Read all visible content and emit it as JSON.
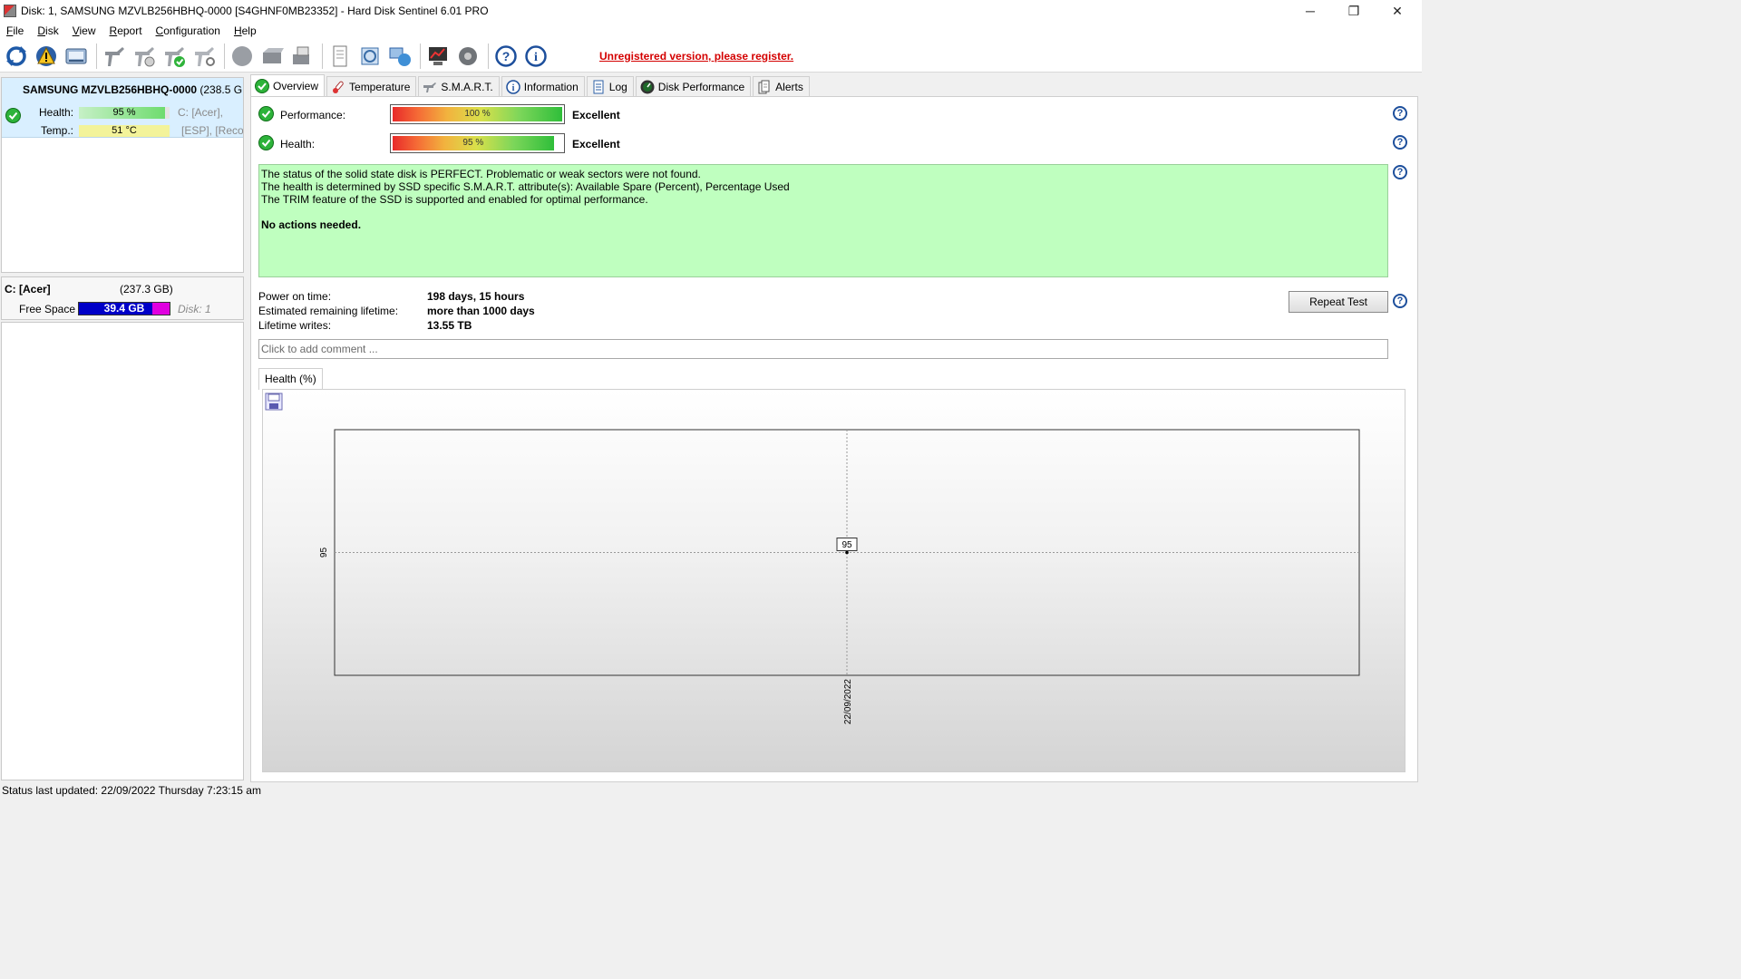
{
  "window": {
    "title": "Disk: 1, SAMSUNG MZVLB256HBHQ-0000 [S4GHNF0MB23352]  -  Hard Disk Sentinel 6.01 PRO",
    "minimize": "─",
    "maximize": "❐",
    "close": "✕"
  },
  "menu": [
    {
      "label": "File",
      "key": "F",
      "rest": "ile"
    },
    {
      "label": "Disk",
      "key": "D",
      "rest": "isk"
    },
    {
      "label": "View",
      "key": "V",
      "rest": "iew"
    },
    {
      "label": "Report",
      "key": "R",
      "rest": "eport"
    },
    {
      "label": "Configuration",
      "key": "C",
      "rest": "onfiguration"
    },
    {
      "label": "Help",
      "key": "H",
      "rest": "elp"
    }
  ],
  "toolbar": {
    "register_text": "Unregistered version, please register.",
    "icons": [
      "refresh-icon",
      "alert-icon",
      "disk-drive-icon",
      "sep",
      "wrench-icon",
      "test-icon",
      "wrench-check-icon",
      "wrench-settings-icon",
      "sep2",
      "circle-icon",
      "server-icon",
      "printer-icon",
      "sep3",
      "report-icon",
      "send-icon",
      "network-icon",
      "sep4",
      "chart-monitor-icon",
      "speaker-icon",
      "sep5",
      "help-icon",
      "info-icon"
    ]
  },
  "left": {
    "disk_name": "SAMSUNG MZVLB256HBHQ-0000",
    "disk_size": "(238.5 G",
    "health_label": "Health:",
    "health_value": "95 %",
    "health_fraction": 0.95,
    "temp_label": "Temp.:",
    "temp_value": "51 °C",
    "partition_1": "C: [Acer],",
    "partition_2": "[ESP],  [Reco",
    "volume_name": "C: [Acer]",
    "volume_size": "(237.3 GB)",
    "free_space_label": "Free Space",
    "free_space_value": "39.4 GB",
    "volume_disk": "Disk: 1"
  },
  "tabs": [
    {
      "label": "Overview",
      "icon": "ok-check-icon",
      "active": true
    },
    {
      "label": "Temperature",
      "icon": "thermometer-icon",
      "active": false
    },
    {
      "label": "S.M.A.R.T.",
      "icon": "smart-disk-icon",
      "active": false
    },
    {
      "label": "Information",
      "icon": "info-disk-icon",
      "active": false
    },
    {
      "label": "Log",
      "icon": "log-icon",
      "active": false
    },
    {
      "label": "Disk Performance",
      "icon": "speedometer-icon",
      "active": false
    },
    {
      "label": "Alerts",
      "icon": "alerts-icon",
      "active": false
    }
  ],
  "overview": {
    "performance_label": "Performance:",
    "performance_value": "100 %",
    "performance_fraction": 1.0,
    "performance_rating": "Excellent",
    "health_label": "Health:",
    "health_value": "95 %",
    "health_fraction": 0.95,
    "health_rating": "Excellent",
    "status_lines": [
      "The status of the solid state disk is PERFECT. Problematic or weak sectors were not found.",
      "The health is determined by SSD specific S.M.A.R.T. attribute(s):  Available Spare (Percent), Percentage Used",
      "The TRIM feature of the SSD is supported and enabled for optimal performance."
    ],
    "actions": "No actions needed.",
    "power_on_label": "Power on time:",
    "power_on_value": "198 days, 15 hours",
    "remaining_label": "Estimated remaining lifetime:",
    "remaining_value": "more than 1000 days",
    "writes_label": "Lifetime writes:",
    "writes_value": "13.55 TB",
    "repeat_test": "Repeat Test",
    "comment_placeholder": "Click to add comment ...",
    "graph_tab": "Health (%)",
    "help_symbol": "?"
  },
  "chart_data": {
    "type": "line",
    "x": [
      "22/09/2022"
    ],
    "series": [
      {
        "values": [
          95
        ]
      }
    ],
    "data_labels": [
      "95"
    ],
    "y_ticks": [
      "95"
    ],
    "x_ticks": [
      "22/09/2022"
    ],
    "grid": true
  },
  "statusbar": {
    "text": "Status last updated: 22/09/2022 Thursday 7:23:15 am"
  },
  "colors": {
    "register": "#d40000",
    "status_bg": "#bfffbf",
    "selected_disk_bg": "#d9efff",
    "free_space_bar": "#0000c8",
    "free_space_used": "#e000e0",
    "temp_bar": "#f3f39a",
    "health_bar": "#78e078"
  }
}
